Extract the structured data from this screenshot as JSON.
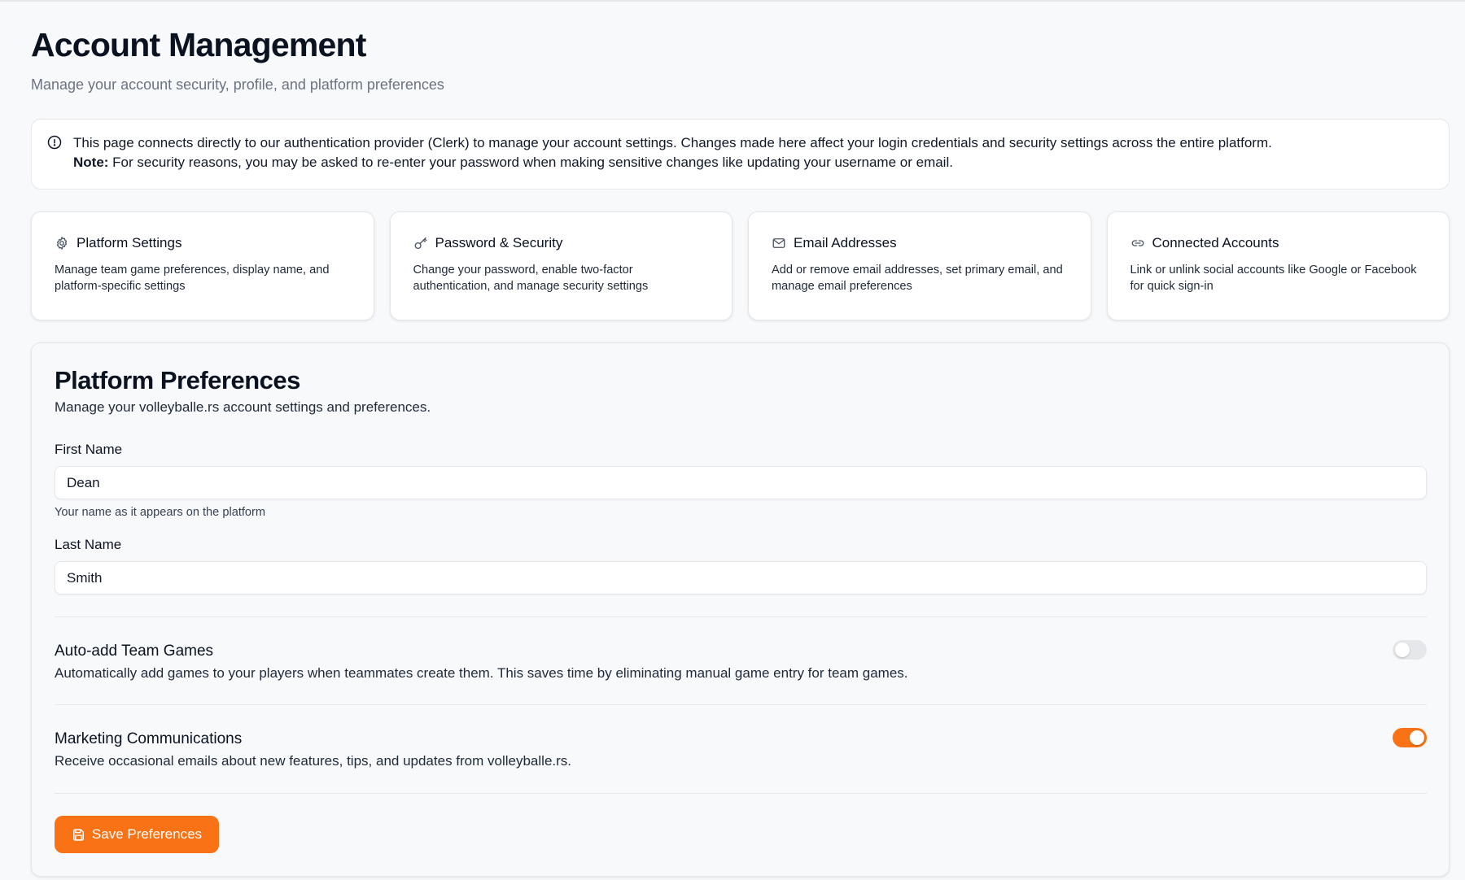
{
  "header": {
    "title": "Account Management",
    "subtitle": "Manage your account security, profile, and platform preferences"
  },
  "notice": {
    "icon": "alert-circle-icon",
    "text": "This page connects directly to our authentication provider (Clerk) to manage your account settings. Changes made here affect your login credentials and security settings across the entire platform.",
    "note_label": "Note:",
    "note_text": " For security reasons, you may be asked to re-enter your password when making sensitive changes like updating your username or email."
  },
  "cards": [
    {
      "icon": "gear-icon",
      "title": "Platform Settings",
      "description": "Manage team game preferences, display name, and platform-specific settings"
    },
    {
      "icon": "key-icon",
      "title": "Password & Security",
      "description": "Change your password, enable two-factor authentication, and manage security settings"
    },
    {
      "icon": "mail-icon",
      "title": "Email Addresses",
      "description": "Add or remove email addresses, set primary email, and manage email preferences"
    },
    {
      "icon": "link-icon",
      "title": "Connected Accounts",
      "description": "Link or unlink social accounts like Google or Facebook for quick sign-in"
    }
  ],
  "preferences": {
    "title": "Platform Preferences",
    "subtitle": "Manage your volleyballe.rs account settings and preferences.",
    "first_name": {
      "label": "First Name",
      "value": "Dean",
      "help": "Your name as it appears on the platform"
    },
    "last_name": {
      "label": "Last Name",
      "value": "Smith"
    },
    "auto_add": {
      "title": "Auto-add Team Games",
      "description": "Automatically add games to your players when teammates create them. This saves time by eliminating manual game entry for team games.",
      "enabled": false
    },
    "marketing": {
      "title": "Marketing Communications",
      "description": "Receive occasional emails about new features, tips, and updates from volleyballe.rs.",
      "enabled": true
    },
    "save_label": "Save Preferences",
    "save_icon": "save-icon"
  },
  "colors": {
    "accent": "#f97316",
    "toggle_off": "#e5e7eb"
  }
}
